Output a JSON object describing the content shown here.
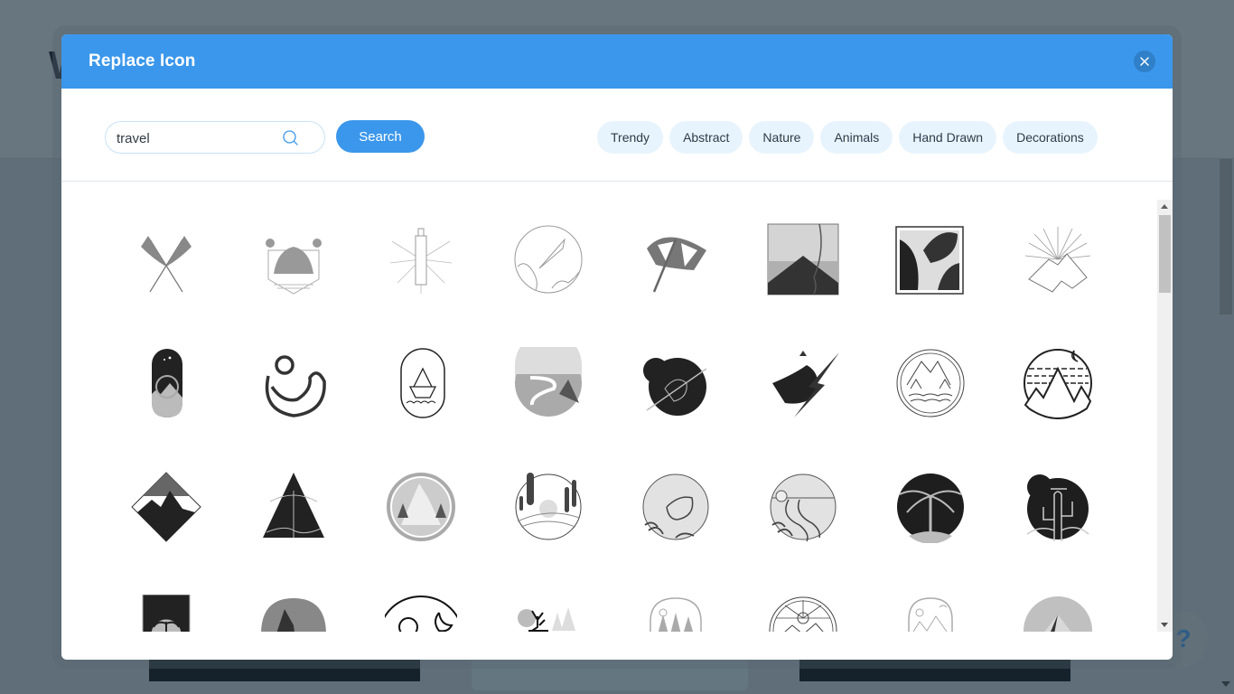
{
  "background": {
    "heading_fragment": "",
    "letter": "W",
    "help_glyph": "?"
  },
  "modal": {
    "title": "Replace Icon",
    "close_label": "×",
    "search": {
      "value": "travel",
      "placeholder": "",
      "button_label": "Search"
    },
    "tags": [
      "Trendy",
      "Abstract",
      "Nature",
      "Animals",
      "Hand Drawn",
      "Decorations"
    ],
    "icons": [
      "crossed-palm-leaves-icon",
      "camel-desert-badge-icon",
      "lighthouse-rays-icon",
      "rocket-clouds-circle-icon",
      "beach-umbrella-icon",
      "mount-fuji-blossom-icon",
      "tropical-leaves-frame-icon",
      "mountain-sunburst-icon",
      "night-mountain-capsule-icon",
      "moon-wave-icon",
      "ship-oval-badge-icon",
      "river-shark-fin-circle-icon",
      "bird-arrow-circle-icon",
      "crowned-bird-lightning-icon",
      "forest-lake-circle-icon",
      "night-peaks-circle-icon",
      "mountain-diamond-icon",
      "palm-pyramid-icon",
      "forest-mountain-circle-icon",
      "cypress-hills-circle-icon",
      "bird-meadow-circle-icon",
      "winding-road-circle-icon",
      "palm-tree-circle-icon",
      "cactus-sun-circle-icon",
      "palm-square-badge-icon",
      "mountain-arch-icon",
      "sun-moon-forest-icon",
      "deer-forest-icon",
      "pine-arch-icon",
      "sunrise-mountain-circle-icon",
      "desert-arch-icon",
      "pyramid-circle-icon"
    ]
  },
  "colors": {
    "accent": "#3b97eb",
    "tag_bg": "#e8f4fd",
    "overlay": "#67757f"
  }
}
